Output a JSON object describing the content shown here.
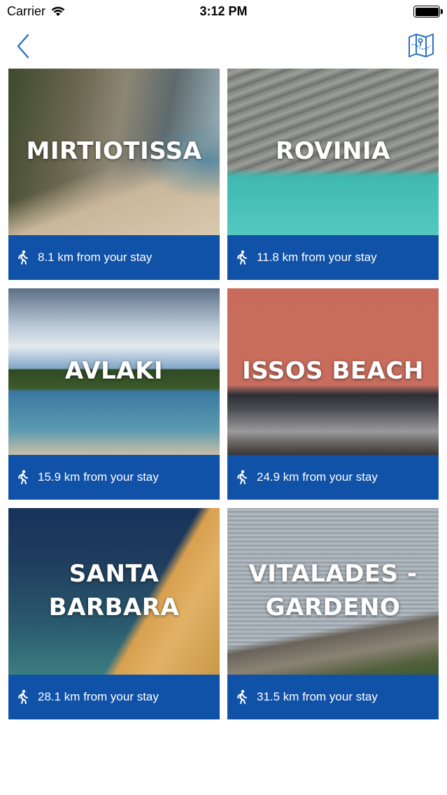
{
  "status_bar": {
    "carrier": "Carrier",
    "time": "3:12 PM",
    "battery_level": 1.0
  },
  "nav": {
    "back_icon": "chevron-left-icon",
    "map_icon": "folded-map-icon",
    "accent_color": "#2a72c4"
  },
  "beaches": [
    {
      "name": "MIRTIOTISSA",
      "distance": "8.1 km from your stay"
    },
    {
      "name": "ROVINIA",
      "distance": "11.8 km from your stay"
    },
    {
      "name": "AVLAKI",
      "distance": "15.9 km from your stay"
    },
    {
      "name": "ISSOS BEACH",
      "distance": "24.9 km from your stay"
    },
    {
      "name": "SANTA BARBARA",
      "distance": "28.1 km from your stay"
    },
    {
      "name": "VITALADES - GARDENO",
      "distance": "31.5 km from your stay"
    }
  ],
  "colors": {
    "footer_background": "#1052a8",
    "footer_text": "#ffffff"
  }
}
